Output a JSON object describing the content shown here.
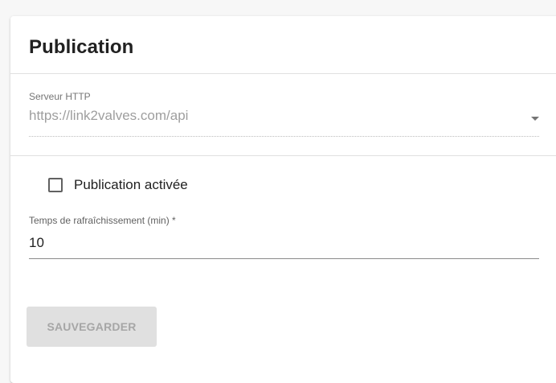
{
  "card": {
    "title": "Publication"
  },
  "http_server": {
    "label": "Serveur HTTP",
    "value": "https://link2valves.com/api",
    "icon": "chevron-down-icon"
  },
  "publication": {
    "checkbox_label": "Publication activée",
    "checked": false
  },
  "refresh": {
    "label": "Temps de rafraîchissement (min) *",
    "value": "10"
  },
  "actions": {
    "save_label": "SAUVEGARDER",
    "save_disabled": true
  },
  "colors": {
    "background": "#f7f7f7",
    "card": "#ffffff",
    "divider": "#e0e0e0",
    "disabled_button_bg": "#e0e0e0",
    "disabled_button_text": "#a6a6a6"
  }
}
